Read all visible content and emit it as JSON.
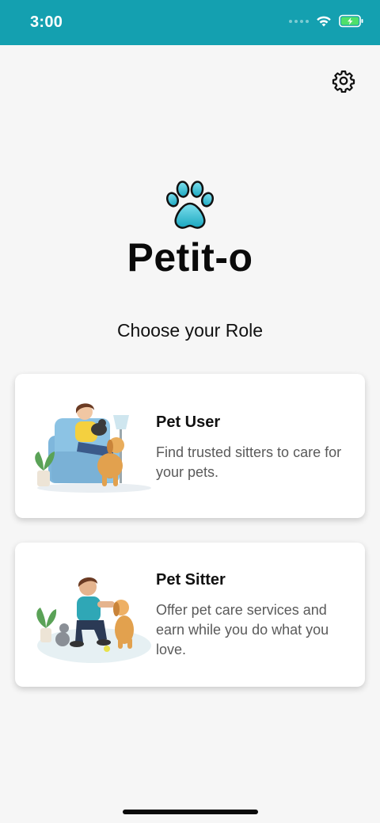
{
  "status_bar": {
    "time": "3:00"
  },
  "header": {
    "settings_icon": "gear-icon"
  },
  "brand": {
    "logo_icon": "paw-icon",
    "name": "Petit-o"
  },
  "main": {
    "title": "Choose your Role",
    "roles": [
      {
        "title": "Pet User",
        "description": "Find trusted sitters to care for your pets.",
        "illustration": "woman-with-dog-and-cat-illustration"
      },
      {
        "title": "Pet Sitter",
        "description": "Offer pet care services and earn while you do what you love.",
        "illustration": "man-with-dog-and-cat-illustration"
      }
    ]
  },
  "colors": {
    "status_bar": "#14a0b0",
    "background": "#f6f6f6",
    "paw": "#3fc3d9",
    "card": "#ffffff"
  }
}
